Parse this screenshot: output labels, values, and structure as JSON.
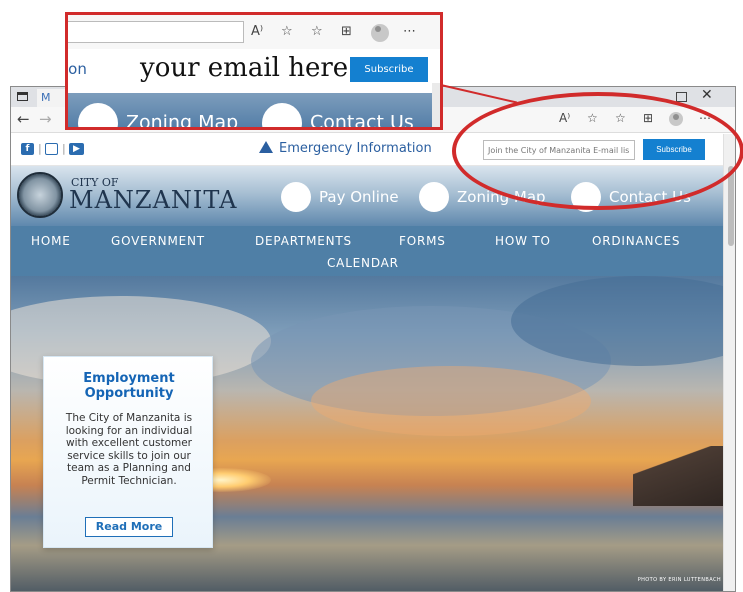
{
  "browser": {
    "tab_label": "M",
    "text_size_icon": "A⁾",
    "window_close": "✕"
  },
  "site": {
    "emergency_label": "Emergency Information",
    "email_placeholder": "Join the City of Manzanita E-mail lis",
    "subscribe_label": "Subscribe",
    "city_of": "CITY OF",
    "city_name": "MANZANITA",
    "quick_links": [
      {
        "label": "Pay Online",
        "icon": "money-icon"
      },
      {
        "label": "Zoning Map",
        "icon": "map-icon"
      },
      {
        "label": "Contact Us",
        "icon": "mail-icon"
      }
    ],
    "nav": [
      "HOME",
      "GOVERNMENT",
      "DEPARTMENTS",
      "FORMS",
      "HOW TO",
      "ORDINANCES",
      "CALENDAR"
    ],
    "photo_credit": "PHOTO BY ERIN LUTTENBACH",
    "card": {
      "title": "Employment Opportunity",
      "body": "The City of Manzanita is looking for an individual with excellent customer service skills to join our team as a Planning and Permit Technician.",
      "button": "Read More"
    }
  },
  "zoom": {
    "emergency_partial": "ion",
    "email_overlay": "your email here",
    "subscribe_label": "Subscribe",
    "zoning_label": "Zoning Map",
    "contact_label": "Contact Us"
  },
  "colors": {
    "accent_blue": "#1480d0",
    "nav_bg": "#4f7fa6",
    "highlight_red": "#d12b2b"
  }
}
